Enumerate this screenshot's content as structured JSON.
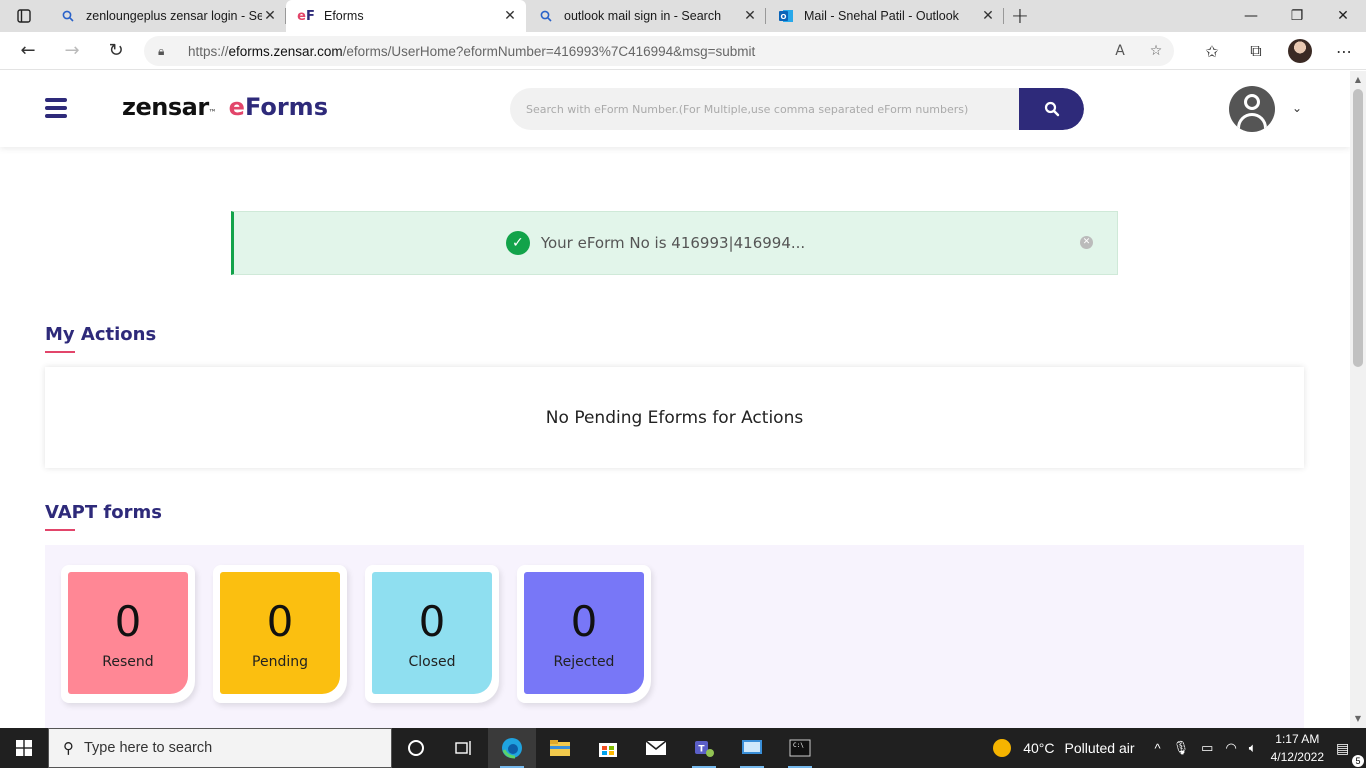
{
  "browser": {
    "tabs": [
      {
        "title": "zenloungeplus zensar login - Sea",
        "favicon": "search-icon"
      },
      {
        "title": "Eforms",
        "favicon": "eforms-logo-icon"
      },
      {
        "title": "outlook mail sign in - Search",
        "favicon": "search-icon"
      },
      {
        "title": "Mail - Snehal Patil - Outlook",
        "favicon": "outlook-icon"
      }
    ],
    "active_tab": 1,
    "url_prefix": "https://",
    "url_host": "eforms.zensar.com",
    "url_path": "/eforms/UserHome?eformNumber=416993%7C416994&msg=submit"
  },
  "header": {
    "logo_main": "zensar",
    "logo_tm": "™",
    "logo_e": "e",
    "logo_forms": "Forms",
    "search_placeholder": "Search with eForm Number.(For Multiple,use comma separated eForm numbers)"
  },
  "alert": {
    "message": "Your eForm No is 416993|416994..."
  },
  "my_actions": {
    "title": "My Actions",
    "empty_message": "No Pending Eforms for Actions"
  },
  "vapt": {
    "title": "VAPT forms",
    "cards": [
      {
        "count": "0",
        "label": "Resend",
        "color": "#ff8795"
      },
      {
        "count": "0",
        "label": "Pending",
        "color": "#fbbf10"
      },
      {
        "count": "0",
        "label": "Closed",
        "color": "#8fdff0"
      },
      {
        "count": "0",
        "label": "Rejected",
        "color": "#7877f7"
      }
    ]
  },
  "taskbar": {
    "search_text": "Type here to search",
    "weather_temp": "40°C",
    "weather_desc": "Polluted air",
    "time": "1:17 AM",
    "date": "4/12/2022",
    "notification_count": "5"
  },
  "colors": {
    "brand_primary": "#2e2a7a",
    "brand_accent": "#e2456a",
    "success": "#12a34a"
  }
}
